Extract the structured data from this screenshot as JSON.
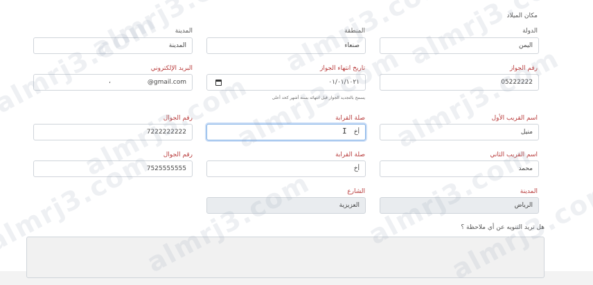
{
  "watermark": "almrj3.com",
  "birth_place": {
    "section_label": "مكان الميلاد"
  },
  "row1": {
    "country": {
      "label": "الدولة",
      "value": "اليمن"
    },
    "region": {
      "label": "المنطقة",
      "value": "صنعاء"
    },
    "city": {
      "label": "المدينة",
      "value": "المدينة"
    }
  },
  "row2": {
    "passport_number": {
      "label": "رقم الجواز",
      "value": "05222222"
    },
    "passport_expiry": {
      "label": "تاريخ انتهاء الجواز",
      "value": "٠١/٠١/١٠٢١",
      "hint": "يسمح بالتجديد الجواز قبل انتهائه بستة أشهر كحد أعلى"
    },
    "email": {
      "label": "البريد الإلكتروني",
      "value": "@gmail.com",
      "extra": "،"
    }
  },
  "row3": {
    "first_relative_name": {
      "label": "اسم القريب الأول",
      "value": "منيل"
    },
    "relationship": {
      "label": "صلة القرابة",
      "value": "أخ"
    },
    "mobile": {
      "label": "رقم الجوال",
      "value": "7222222222"
    }
  },
  "row4": {
    "second_relative_name": {
      "label": "اسم القريب الثاني",
      "value": "محمد"
    },
    "relationship": {
      "label": "صلة القرابة",
      "value": "أخ"
    },
    "mobile": {
      "label": "رقم الجوال",
      "value": "7525555555"
    }
  },
  "row5": {
    "city": {
      "label": "المدينة",
      "value": "الرياض"
    },
    "street": {
      "label": "الشارع",
      "value": "العزيزية"
    }
  },
  "note_question": "هل تريد التنويه عن أي ملاحظة ؟"
}
